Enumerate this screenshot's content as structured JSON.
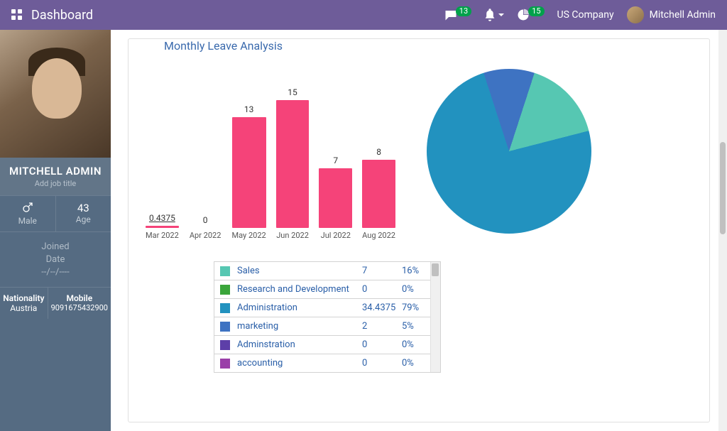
{
  "navbar": {
    "title": "Dashboard",
    "messages_badge": "13",
    "activities_badge": "15",
    "company": "US Company",
    "user_name": "Mitchell Admin"
  },
  "profile": {
    "name": "MITCHELL ADMIN",
    "job_title_placeholder": "Add job title",
    "gender_label": "Male",
    "age_value": "43",
    "age_label": "Age",
    "joined_label": "Joined",
    "date_label": "Date",
    "date_value": "--/--/----",
    "nationality_label": "Nationality",
    "nationality_value": "Austria",
    "mobile_label": "Mobile",
    "mobile_value": "9091675432900"
  },
  "chart_title": "Monthly Leave Analysis",
  "chart_data": [
    {
      "type": "bar",
      "title": "Monthly Leave Analysis",
      "categories": [
        "Mar 2022",
        "Apr 2022",
        "May 2022",
        "Jun 2022",
        "Jul 2022",
        "Aug 2022"
      ],
      "values": [
        0.4375,
        0,
        13,
        15,
        7,
        8
      ],
      "ylim": [
        0,
        15
      ],
      "color": "#f54379"
    },
    {
      "type": "pie",
      "series": [
        {
          "name": "Sales",
          "value": 7,
          "pct": "16%",
          "color": "#56c7b2"
        },
        {
          "name": "Research and Development",
          "value": 0,
          "pct": "0%",
          "color": "#3aa53a"
        },
        {
          "name": "Administration",
          "value": 34.4375,
          "pct": "79%",
          "color": "#2292bf"
        },
        {
          "name": "marketing",
          "value": 2,
          "pct": "5%",
          "color": "#3e73c2"
        },
        {
          "name": "Adminstration",
          "value": 0,
          "pct": "0%",
          "color": "#5d3fa8"
        },
        {
          "name": "accounting",
          "value": 0,
          "pct": "0%",
          "color": "#9a3fa8"
        }
      ]
    }
  ]
}
